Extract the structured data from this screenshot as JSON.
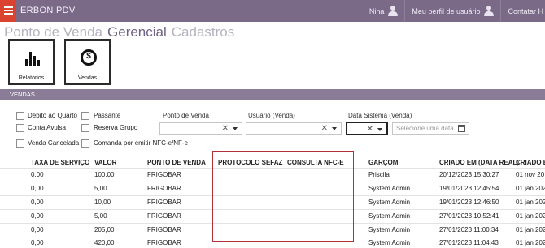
{
  "app": {
    "title": "ERBON PDV"
  },
  "topbar": {
    "user_name": "Nina",
    "profile_link": "Meu perfil de usuário",
    "contact_link": "Contatar H"
  },
  "modules": {
    "tabs": [
      "Ponto de Venda",
      "Gerencial",
      "Cadastros"
    ],
    "active": "Gerencial"
  },
  "tiles": [
    {
      "label": "Relatórios",
      "icon": "bar-chart-icon"
    },
    {
      "label": "Vendas",
      "icon": "dollar-coin-icon"
    }
  ],
  "section": {
    "title": "VENDAS"
  },
  "filters": {
    "checkboxes": [
      "Débito ao Quarto",
      "Passante",
      "Conta Avulsa",
      "Reserva Grupo",
      "Venda Cancelada",
      "Comanda por emitir NFC-e/NF-e"
    ],
    "ponto_venda_label": "Ponto de Venda",
    "usuario_label": "Usuário (Venda)",
    "data_sistema_label": "Data Sistema (Venda)",
    "clear_glyph": "✕",
    "date_placeholder": "Selecione uma data"
  },
  "table": {
    "columns": [
      "TAXA DE SERVIÇO",
      "VALOR",
      "PONTO DE VENDA",
      "PROTOCOLO SEFAZ",
      "CONSULTA NFC-E",
      "GARÇOM",
      "CRIADO EM (DATA REAL)",
      "CRIADO E"
    ],
    "rows": [
      [
        "0,00",
        "100,00",
        "FRIGOBAR",
        "",
        "",
        "Priscila",
        "20/12/2023 15:30:27",
        "01 nov 20"
      ],
      [
        "0,00",
        "5,00",
        "FRIGOBAR",
        "",
        "",
        "System Admin",
        "19/01/2023 12:45:54",
        "01 jan 202"
      ],
      [
        "0,00",
        "10,00",
        "FRIGOBAR",
        "",
        "",
        "System Admin",
        "19/01/2023 12:46:50",
        "01 jan 202"
      ],
      [
        "0,00",
        "5,00",
        "FRIGOBAR",
        "",
        "",
        "System Admin",
        "27/01/2023 10:52:41",
        "01 jan 202"
      ],
      [
        "0,00",
        "205,00",
        "FRIGOBAR",
        "",
        "",
        "System Admin",
        "27/01/2023 11:00:34",
        "01 jan 202"
      ],
      [
        "0,00",
        "420,00",
        "FRIGOBAR",
        "",
        "",
        "System Admin",
        "27/01/2023 11:04:43",
        "01 jan 202"
      ]
    ]
  },
  "colors": {
    "topbar": "#7a6a88",
    "menu_button": "#d9432f",
    "section_bar": "#8a7b97",
    "highlight_box": "#b23038"
  }
}
